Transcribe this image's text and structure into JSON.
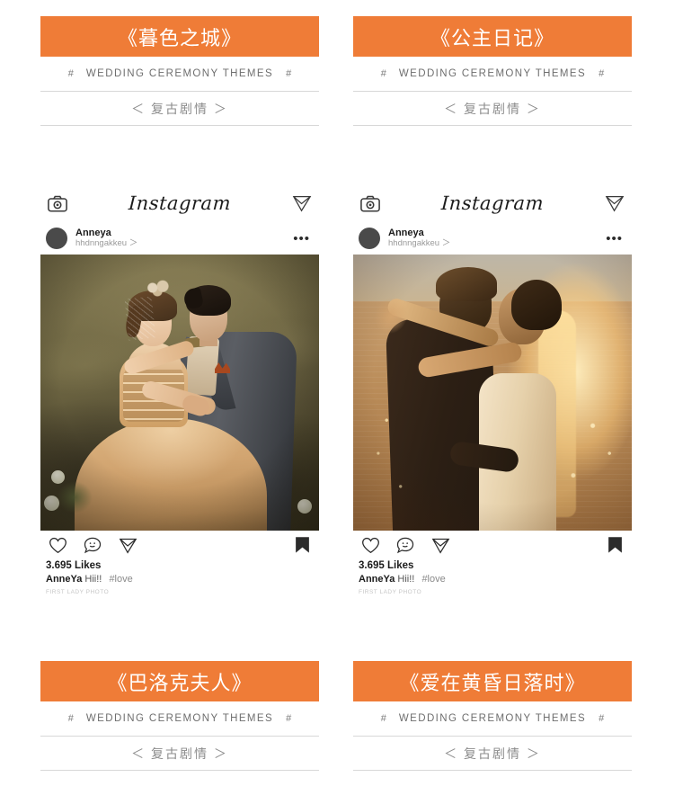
{
  "theme": {
    "accent_color": "#ef7c37",
    "background_color": "#ffffff",
    "divider_color": "#d8d8d8",
    "muted_text_color": "#8c8c8c"
  },
  "title_blocks": [
    {
      "id": "top-left",
      "title": "《暮色之城》",
      "hash_left": "#",
      "hash_right": "#",
      "hash_text": "WEDDING CEREMONY THEMES",
      "subtitle": "＜ 复古剧情 ＞"
    },
    {
      "id": "top-right",
      "title": "《公主日记》",
      "hash_left": "#",
      "hash_right": "#",
      "hash_text": "WEDDING CEREMONY THEMES",
      "subtitle": "＜ 复古剧情 ＞"
    },
    {
      "id": "bottom-left",
      "title": "《巴洛克夫人》",
      "hash_left": "#",
      "hash_right": "#",
      "hash_text": "WEDDING CEREMONY THEMES",
      "subtitle": "＜ 复古剧情 ＞"
    },
    {
      "id": "bottom-right",
      "title": "《爱在黄昏日落时》",
      "hash_left": "#",
      "hash_right": "#",
      "hash_text": "WEDDING CEREMONY THEMES",
      "subtitle": "＜ 复古剧情 ＞"
    }
  ],
  "instagram_cards": [
    {
      "id": "card-left",
      "brand": "Instagram",
      "camera_icon": "camera-icon",
      "send_icon": "send-icon",
      "username": "Anneya",
      "handle": "hhdnngakkeu ＞",
      "more_icon": "•••",
      "photo_alt": "studio wedding portrait of couple in gold gown and grey suit",
      "likes": "3.695 Likes",
      "caption_user": "AnneYa",
      "caption_text": "Hii!!",
      "caption_tag": "#love",
      "footnote": "FIRST LADY PHOTO"
    },
    {
      "id": "card-right",
      "brand": "Instagram",
      "camera_icon": "camera-icon",
      "send_icon": "send-icon",
      "username": "Anneya",
      "handle": "hhdnngakkeu ＞",
      "more_icon": "•••",
      "photo_alt": "sunset backlit couple embracing by the sea",
      "likes": "3.695 Likes",
      "caption_user": "AnneYa",
      "caption_text": "Hii!!",
      "caption_tag": "#love",
      "footnote": "FIRST LADY PHOTO"
    }
  ],
  "action_icons": {
    "like": "heart-icon",
    "comment": "comment-smiley-icon",
    "share": "send-icon",
    "save": "bookmark-icon"
  }
}
